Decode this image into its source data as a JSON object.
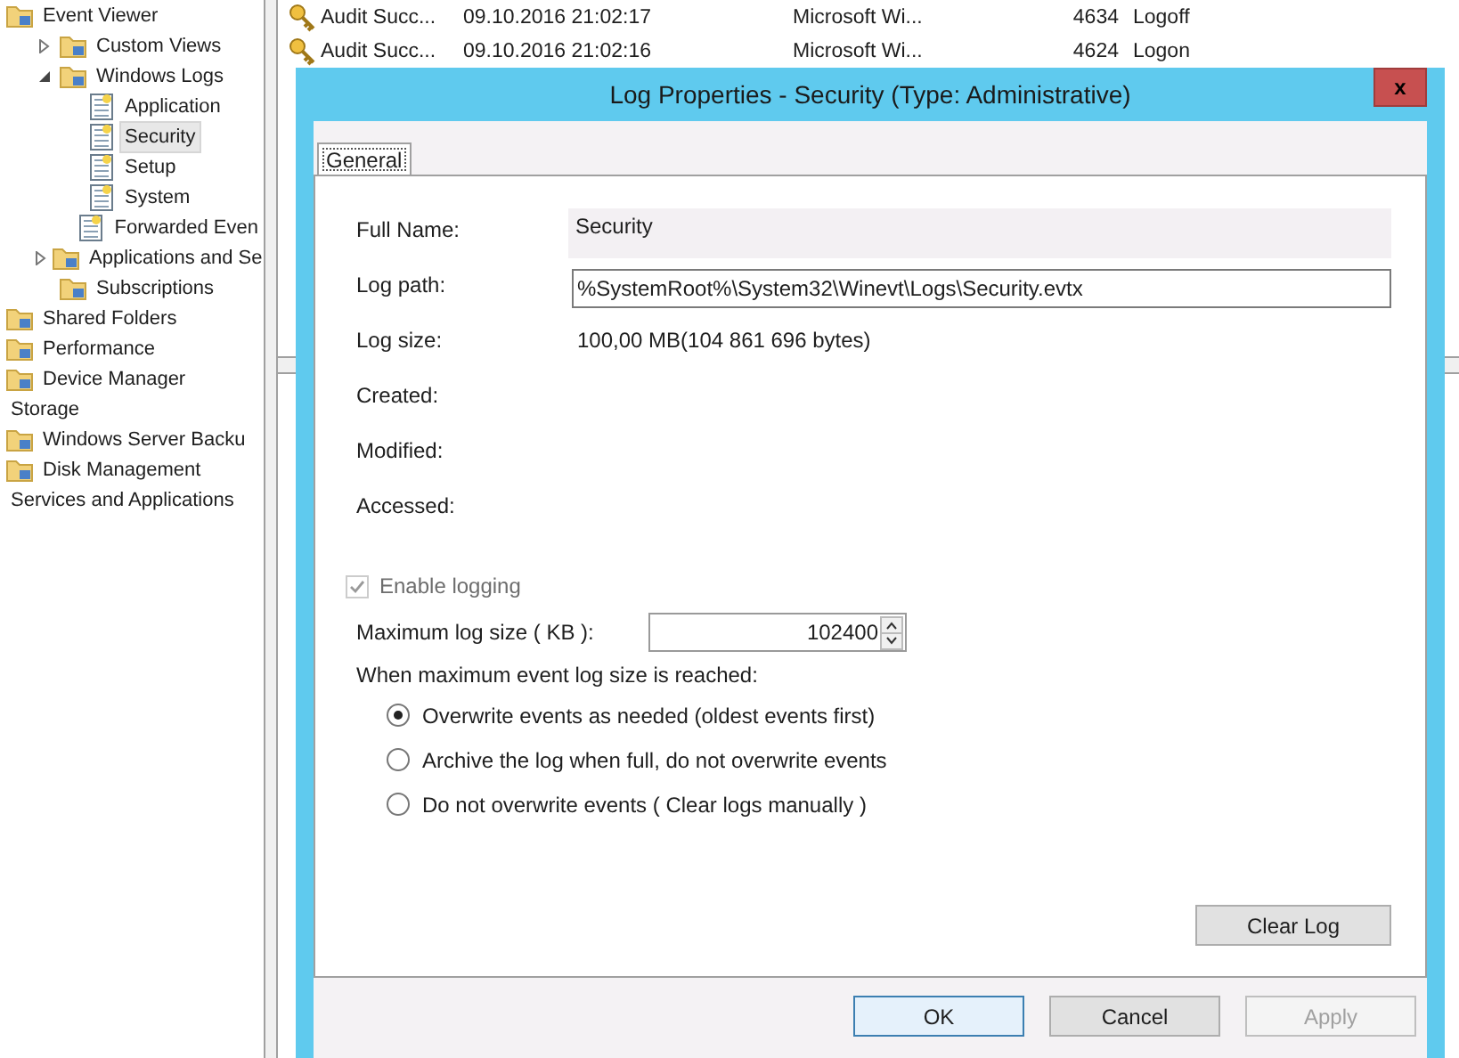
{
  "tree": [
    {
      "label": "Event Viewer",
      "kind": "node",
      "selected": false,
      "children": [
        {
          "label": "Custom Views",
          "kind": "node",
          "expanded": false,
          "selected": false
        },
        {
          "label": "Windows Logs",
          "kind": "node",
          "expanded": true,
          "selected": false,
          "children": [
            {
              "label": "Application",
              "kind": "node",
              "selected": false
            },
            {
              "label": "Security",
              "kind": "node",
              "selected": true
            },
            {
              "label": "Setup",
              "kind": "node",
              "selected": false
            },
            {
              "label": "System",
              "kind": "node",
              "selected": false
            },
            {
              "label": "Forwarded Even",
              "kind": "node",
              "selected": false
            }
          ]
        },
        {
          "label": "Applications and Se",
          "kind": "node",
          "expanded": false,
          "selected": false
        },
        {
          "label": "Subscriptions",
          "kind": "node",
          "selected": false
        }
      ]
    },
    {
      "label": "Shared Folders",
      "kind": "node",
      "selected": false
    },
    {
      "label": "Performance",
      "kind": "node",
      "selected": false
    },
    {
      "label": "Device Manager",
      "kind": "node",
      "selected": false
    },
    {
      "label": "Storage",
      "kind": "group",
      "selected": false
    },
    {
      "label": "Windows Server Backu",
      "kind": "node",
      "selected": false
    },
    {
      "label": "Disk Management",
      "kind": "node",
      "selected": false
    },
    {
      "label": "Services and Applications",
      "kind": "group",
      "selected": false
    }
  ],
  "events": [
    {
      "level": "Audit Succ...",
      "date": "09.10.2016 21:02:17",
      "source": "Microsoft Wi...",
      "event_id": "4634",
      "category": "Logoff"
    },
    {
      "level": "Audit Succ...",
      "date": "09.10.2016 21:02:16",
      "source": "Microsoft Wi...",
      "event_id": "4624",
      "category": "Logon"
    }
  ],
  "dialog": {
    "title": "Log Properties - Security (Type: Administrative)",
    "close": "x",
    "tabs": [
      {
        "label": "General",
        "selected": true
      }
    ],
    "fields": [
      {
        "label": "Full Name:",
        "value": "Security",
        "kind": "readonly"
      },
      {
        "label": "Log path:",
        "value": "%SystemRoot%\\System32\\Winevt\\Logs\\Security.evtx",
        "kind": "input"
      },
      {
        "label": "Log size:",
        "value": "100,00 MB(104 861 696 bytes)",
        "kind": "text"
      },
      {
        "label": "Created:",
        "kind": "text"
      },
      {
        "label": "Modified:",
        "kind": "text"
      },
      {
        "label": "Accessed:",
        "kind": "text"
      }
    ],
    "enable_logging": {
      "label": "Enable logging",
      "checked": true,
      "disabled": true
    },
    "max_size": {
      "label": "Maximum log size ( KB ):",
      "value": "102400"
    },
    "policy_label": "When maximum event log size is reached:",
    "policies": [
      {
        "label": "Overwrite events as needed (oldest events first)",
        "selected": true
      },
      {
        "label": "Archive the log when full, do not overwrite events",
        "selected": false
      },
      {
        "label": "Do not overwrite events ( Clear logs manually )",
        "selected": false
      }
    ],
    "clear_button": "Clear Log",
    "buttons": [
      {
        "label": "OK",
        "default": true,
        "disabled": false
      },
      {
        "label": "Cancel",
        "default": false,
        "disabled": false
      },
      {
        "label": "Apply",
        "default": false,
        "disabled": true
      }
    ]
  }
}
